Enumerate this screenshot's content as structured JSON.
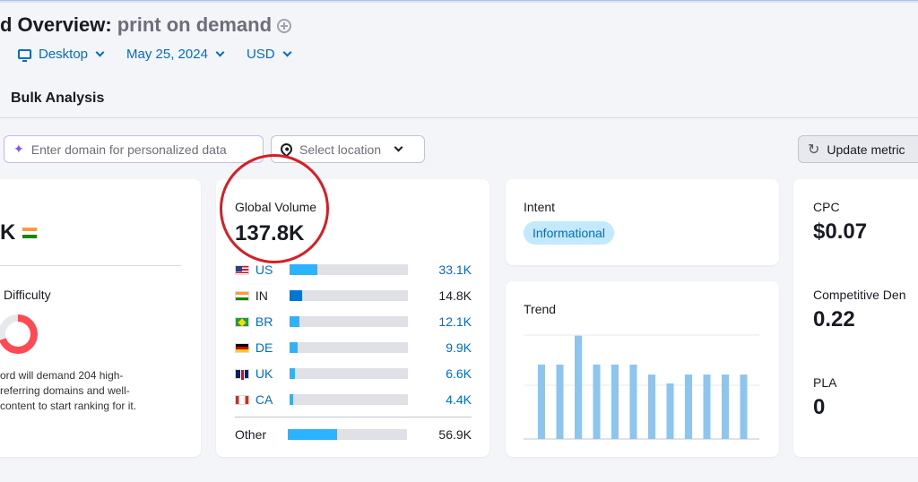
{
  "header": {
    "title_main": "d Overview:",
    "title_keyword": "print on demand",
    "filters": {
      "device": "Desktop",
      "date": "May 25, 2024",
      "currency": "USD"
    }
  },
  "tabs": {
    "bulk_analysis": "Bulk Analysis"
  },
  "toolbar": {
    "domain_placeholder": "Enter domain for personalized data",
    "location_placeholder": "Select location",
    "update_label": "Update metric"
  },
  "card_volume": {
    "value": "K",
    "kd_label": "Difficulty",
    "kd_percent": 70,
    "description": "ord will demand 204 high-\nreferring domains and well-\n content to start ranking for it."
  },
  "global_volume": {
    "label": "Global Volume",
    "value": "137.8K",
    "countries": [
      {
        "code": "US",
        "value": "33.1K",
        "share": 0.24,
        "link": true
      },
      {
        "code": "IN",
        "value": "14.8K",
        "share": 0.107,
        "link": false
      },
      {
        "code": "BR",
        "value": "12.1K",
        "share": 0.088,
        "link": true
      },
      {
        "code": "DE",
        "value": "9.9K",
        "share": 0.072,
        "link": true
      },
      {
        "code": "UK",
        "value": "6.6K",
        "share": 0.048,
        "link": true
      },
      {
        "code": "CA",
        "value": "4.4K",
        "share": 0.032,
        "link": true
      }
    ],
    "other": {
      "label": "Other",
      "value": "56.9K",
      "share": 0.413
    }
  },
  "intent": {
    "label": "Intent",
    "badge": "Informational"
  },
  "trend": {
    "label": "Trend",
    "values": [
      0.67,
      0.67,
      0.93,
      0.67,
      0.67,
      0.67,
      0.58,
      0.5,
      0.58,
      0.58,
      0.58,
      0.58
    ],
    "bar_color": "#8cc5f0"
  },
  "metrics": {
    "cpc_label": "CPC",
    "cpc_value": "$0.07",
    "comp_label": "Competitive Den",
    "comp_value": "0.22",
    "pla_label": "PLA",
    "pla_value": "0"
  }
}
